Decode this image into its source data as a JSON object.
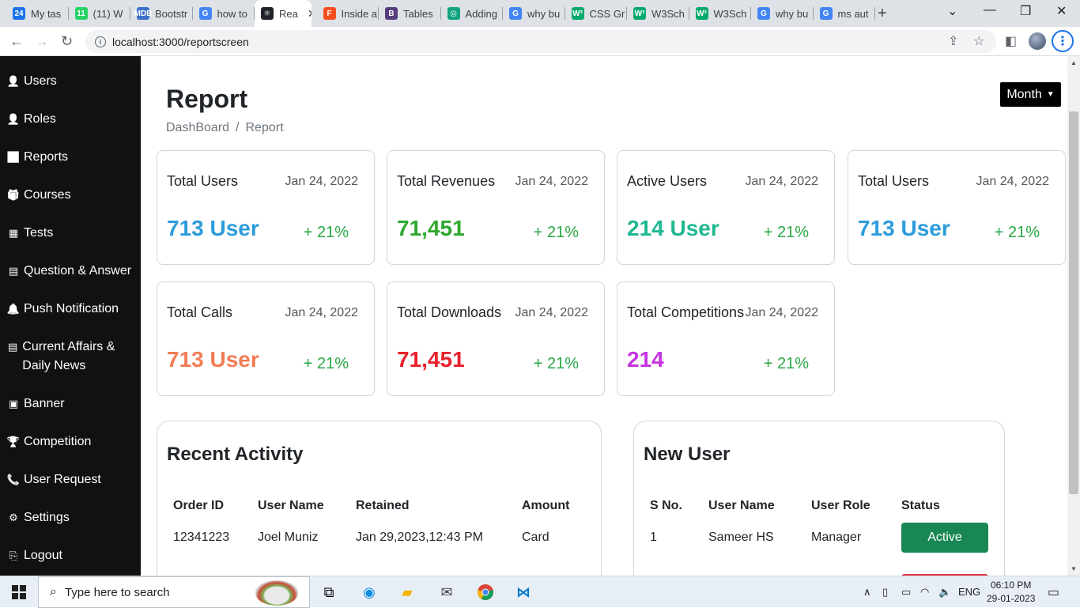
{
  "browser": {
    "tabs": [
      {
        "label": "My tas",
        "favicon": "24",
        "color": "#1a73e8",
        "active": false
      },
      {
        "label": "(11) W",
        "favicon": "11",
        "color": "#25d366",
        "active": false
      },
      {
        "label": "Bootstr",
        "favicon": "MDB",
        "color": "#3b71ca",
        "active": false
      },
      {
        "label": "how to",
        "favicon": "G",
        "color": "#4285f4",
        "active": false
      },
      {
        "label": "Rea",
        "favicon": "⚛",
        "color": "#20232a",
        "active": true
      },
      {
        "label": "Inside a",
        "favicon": "F",
        "color": "#f24e1e",
        "active": false
      },
      {
        "label": "Tables",
        "favicon": "B",
        "color": "#563d7c",
        "active": false
      },
      {
        "label": "Adding",
        "favicon": "◎",
        "color": "#10a37f",
        "active": false
      },
      {
        "label": "why bu",
        "favicon": "G",
        "color": "#4285f4",
        "active": false
      },
      {
        "label": "CSS Gr",
        "favicon": "W³",
        "color": "#04aa6d",
        "active": false
      },
      {
        "label": "W3Sch",
        "favicon": "W³",
        "color": "#04aa6d",
        "active": false
      },
      {
        "label": "W3Sch",
        "favicon": "W³",
        "color": "#04aa6d",
        "active": false
      },
      {
        "label": "why bu",
        "favicon": "G",
        "color": "#4285f4",
        "active": false
      },
      {
        "label": "ms aut",
        "favicon": "G",
        "color": "#4285f4",
        "active": false
      }
    ],
    "url": "localhost:3000/reportscreen"
  },
  "sidebar": {
    "items": [
      {
        "label": "Users",
        "icon": "user-icon",
        "glyph": "👤"
      },
      {
        "label": "Roles",
        "icon": "user-cog-icon",
        "glyph": "👤"
      },
      {
        "label": "Reports",
        "icon": "report-icon",
        "glyph": "📈"
      },
      {
        "label": "Courses",
        "icon": "courses-icon",
        "glyph": "🎁"
      },
      {
        "label": "Tests",
        "icon": "tests-icon",
        "glyph": "▦"
      },
      {
        "label": "Question & Answer",
        "icon": "qa-icon",
        "glyph": "▤"
      },
      {
        "label": "Push Notification",
        "icon": "bell-icon",
        "glyph": "🔔"
      },
      {
        "label": "Current Affairs & Daily News",
        "icon": "news-icon",
        "glyph": "▤"
      },
      {
        "label": "Banner",
        "icon": "banner-icon",
        "glyph": "▣"
      },
      {
        "label": "Competition",
        "icon": "trophy-icon",
        "glyph": "🏆"
      },
      {
        "label": "User Request",
        "icon": "phone-icon",
        "glyph": "📞"
      },
      {
        "label": "Settings",
        "icon": "gear-icon",
        "glyph": "⚙"
      },
      {
        "label": "Logout",
        "icon": "logout-icon",
        "glyph": "⎘"
      }
    ]
  },
  "header": {
    "title": "Report",
    "breadcrumb": [
      "DashBoard",
      "/",
      "Report"
    ],
    "period_select": "Month"
  },
  "cards": [
    {
      "title": "Total Users",
      "date": "Jan 24, 2022",
      "value": "713 User",
      "change": "+ 21%",
      "color": "#2d9cdb"
    },
    {
      "title": "Total Revenues",
      "date": "Jan 24, 2022",
      "value": "71,451",
      "change": "+ 21%",
      "color": "#2fa82f"
    },
    {
      "title": "Active Users",
      "date": "Jan 24, 2022",
      "value": "214 User",
      "change": "+ 21%",
      "color": "#1fb892"
    },
    {
      "title": "Total Users",
      "date": "Jan 24, 2022",
      "value": "713 User",
      "change": "+ 21%",
      "color": "#2d9cdb"
    },
    {
      "title": "Total Calls",
      "date": "Jan 24, 2022",
      "value": "713 User",
      "change": "+ 21%",
      "color": "#f27c56"
    },
    {
      "title": "Total Downloads",
      "date": "Jan 24, 2022",
      "value": "71,451",
      "change": "+ 21%",
      "color": "#e8202b"
    },
    {
      "title": "Total Competitions",
      "date": "Jan 24, 2022",
      "value": "214",
      "change": "+ 21%",
      "color": "#c634e0"
    }
  ],
  "recent_activity": {
    "title": "Recent Activity",
    "columns": [
      "Order ID",
      "User Name",
      "Retained",
      "Amount"
    ],
    "rows": [
      [
        "12341223",
        "Joel Muniz",
        "Jan 29,2023,12:43 PM",
        "Card"
      ]
    ]
  },
  "new_user": {
    "title": "New User",
    "columns": [
      "S No.",
      "User Name",
      "User Role",
      "Status"
    ],
    "rows": [
      {
        "sno": "1",
        "name": "Sameer HS",
        "role": "Manager",
        "status": "Active"
      }
    ]
  },
  "taskbar": {
    "search_placeholder": "Type here to search",
    "language": "ENG",
    "time": "06:10 PM",
    "date": "29-01-2023"
  }
}
